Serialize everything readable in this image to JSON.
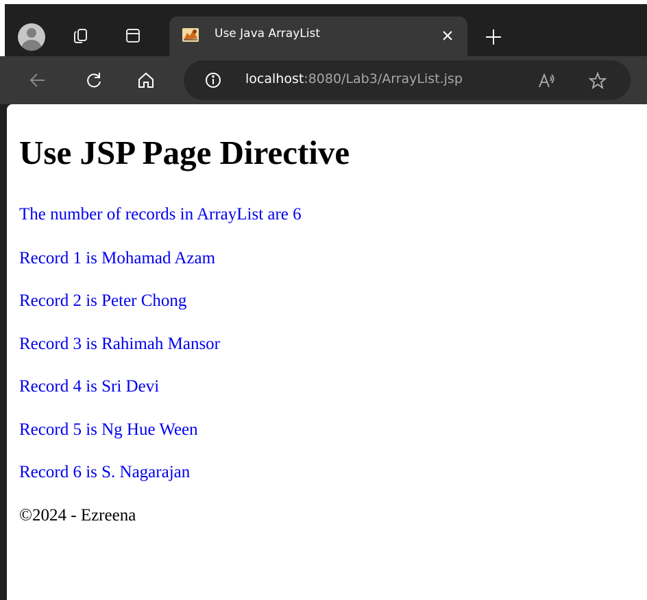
{
  "browser": {
    "tab": {
      "title": "Use Java ArrayList"
    },
    "address_bar": {
      "host": "localhost",
      "rest": ":8080/Lab3/ArrayList.jsp"
    },
    "icons": {
      "profile": "profile-avatar-icon",
      "workspaces": "workspaces-icon",
      "tab_actions": "tab-actions-icon",
      "favicon": "tomcat-favicon-icon",
      "close": "close-icon",
      "new_tab": "plus-icon",
      "back": "back-arrow-icon",
      "refresh": "refresh-icon",
      "home": "home-icon",
      "info": "info-icon",
      "read_aloud": "read-aloud-icon",
      "favorite": "star-icon"
    },
    "colors": {
      "chrome_dark": "#202020",
      "toolbar": "#383838",
      "omnibox": "#282828"
    }
  },
  "page": {
    "heading": "Use JSP Page Directive",
    "count_line": "The number of records in ArrayList are 6",
    "records": [
      "Record 1 is Mohamad Azam",
      "Record 2 is Peter Chong",
      "Record 3 is Rahimah Mansor",
      "Record 4 is Sri Devi",
      "Record 5 is Ng Hue Ween",
      "Record 6 is S. Nagarajan"
    ],
    "footer": "©2024 - Ezreena",
    "colors": {
      "text_blue": "#0000ee",
      "text_black": "#000000"
    }
  }
}
